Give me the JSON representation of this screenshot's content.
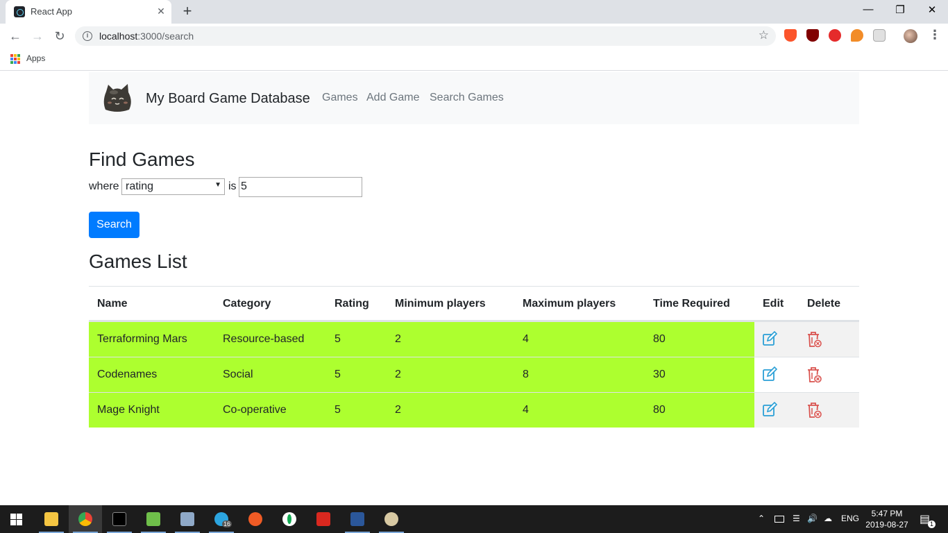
{
  "browser": {
    "tab_title": "React App",
    "tab_close": "✕",
    "new_tab": "+",
    "url_host": "localhost",
    "url_path": ":3000/search",
    "bookmarks_apps": "Apps"
  },
  "navbar": {
    "brand": "My Board Game Database",
    "links": [
      "Games",
      "Add Game",
      "Search Games"
    ]
  },
  "search": {
    "heading": "Find Games",
    "where_label": "where",
    "field_selected": "rating",
    "is_label": "is",
    "value": "5",
    "button_label": "Search"
  },
  "games": {
    "heading": "Games List",
    "columns": [
      "Name",
      "Category",
      "Rating",
      "Minimum players",
      "Maximum players",
      "Time Required",
      "Edit",
      "Delete"
    ],
    "rows": [
      {
        "name": "Terraforming Mars",
        "category": "Resource-based",
        "rating": "5",
        "min": "2",
        "max": "4",
        "time": "80"
      },
      {
        "name": "Codenames",
        "category": "Social",
        "rating": "5",
        "min": "2",
        "max": "8",
        "time": "30"
      },
      {
        "name": "Mage Knight",
        "category": "Co-operative",
        "rating": "5",
        "min": "2",
        "max": "4",
        "time": "80"
      }
    ],
    "highlight_color": "#adff2f"
  },
  "taskbar": {
    "language": "ENG",
    "time": "5:47 PM",
    "date": "2019-08-27",
    "telegram_badge": "16",
    "notifications_badge": "1"
  },
  "colors": {
    "primary": "#007bff",
    "edit_icon": "#2a9fd6",
    "delete_icon": "#d9534f"
  }
}
